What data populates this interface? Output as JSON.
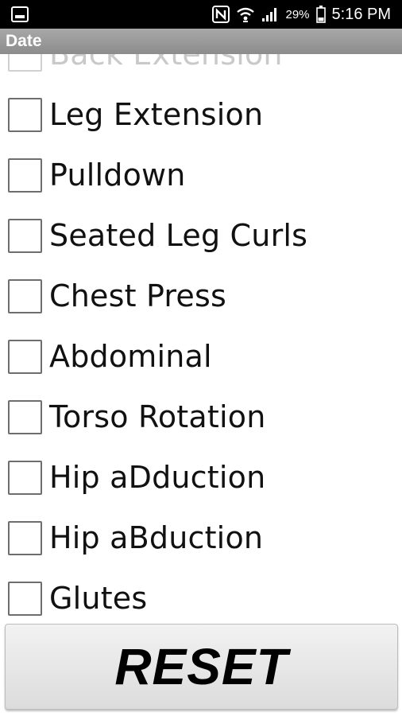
{
  "status_bar": {
    "battery_percent": "29%",
    "time": "5:16 PM",
    "icons": [
      "gallery-icon",
      "nfc-icon",
      "wifi-icon",
      "signal-icon",
      "battery-icon"
    ]
  },
  "title": "Date",
  "exercises": [
    {
      "label": "Back Extension",
      "checked": false
    },
    {
      "label": "Leg Extension",
      "checked": false
    },
    {
      "label": "Pulldown",
      "checked": false
    },
    {
      "label": "Seated Leg Curls",
      "checked": false
    },
    {
      "label": "Chest Press",
      "checked": false
    },
    {
      "label": "Abdominal",
      "checked": false
    },
    {
      "label": "Torso Rotation",
      "checked": false
    },
    {
      "label": "Hip aDduction",
      "checked": false
    },
    {
      "label": "Hip aBduction",
      "checked": false
    },
    {
      "label": "Glutes",
      "checked": false
    }
  ],
  "reset_label": "RESET"
}
